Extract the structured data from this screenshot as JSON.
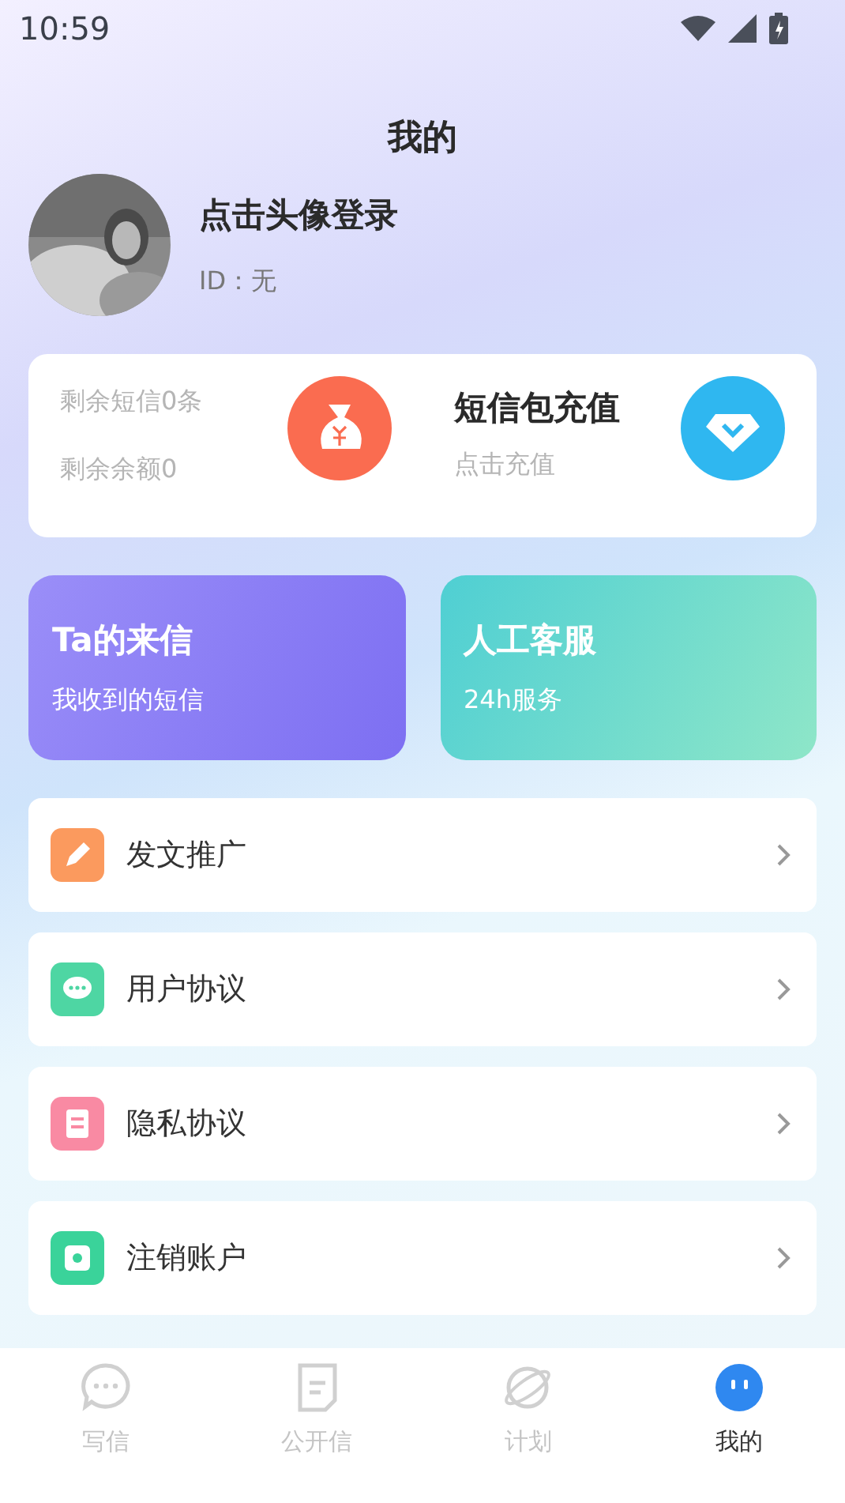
{
  "status_bar": {
    "time": "10:59"
  },
  "header": {
    "title": "我的"
  },
  "profile": {
    "name": "点击头像登录",
    "id": "ID：无"
  },
  "balance_card": {
    "sms_left": "剩余短信0条",
    "amount_left": "剩余余额0",
    "recharge_title": "短信包充值",
    "recharge_hint": "点击充值"
  },
  "feature_cards": [
    {
      "kind": "letters",
      "title": "Ta的来信",
      "subtitle": "我收到的短信"
    },
    {
      "kind": "service",
      "title": "人工客服",
      "subtitle": "24h服务"
    }
  ],
  "menu": [
    {
      "kind": "promote",
      "label": "发文推广"
    },
    {
      "kind": "agreement",
      "label": "用户协议"
    },
    {
      "kind": "privacy",
      "label": "隐私协议"
    },
    {
      "kind": "cancel",
      "label": "注销账户"
    }
  ],
  "tab_bar": [
    {
      "kind": "write",
      "label": "写信",
      "selected": false
    },
    {
      "kind": "public",
      "label": "公开信",
      "selected": false
    },
    {
      "kind": "plan",
      "label": "计划",
      "selected": false
    },
    {
      "kind": "mine",
      "label": "我的",
      "selected": true
    }
  ]
}
